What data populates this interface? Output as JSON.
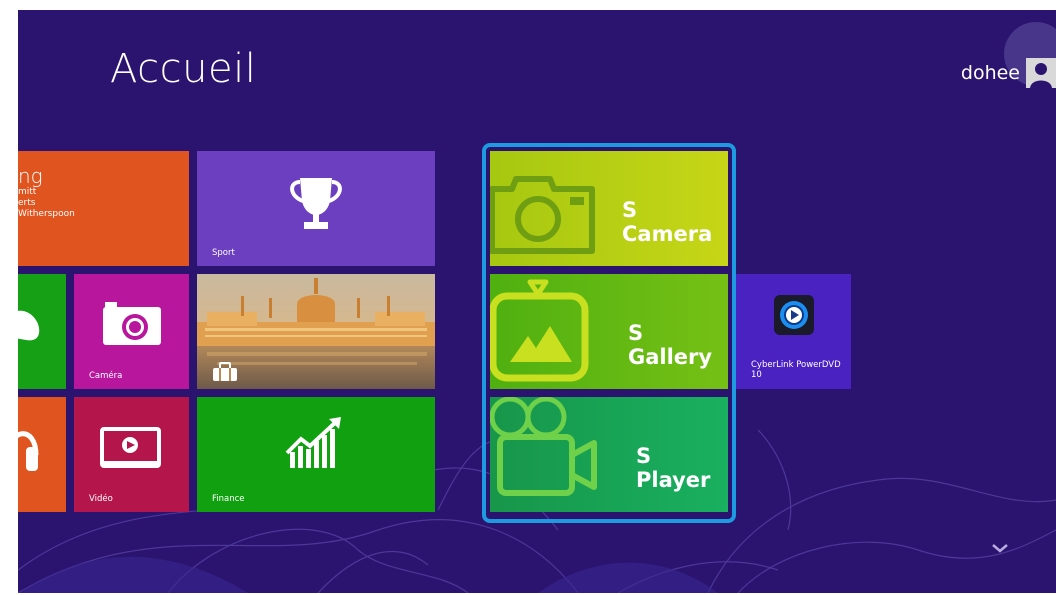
{
  "start": {
    "title": "Accueil",
    "user_name": "dohee"
  },
  "tiles": {
    "people": {
      "lines": [
        "ng",
        "mitt",
        "erts",
        "Witherspoon"
      ]
    },
    "sport": {
      "label": "Sport"
    },
    "camera": {
      "label": "Caméra"
    },
    "video": {
      "label": "Vidéo"
    },
    "finance": {
      "label": "Finance"
    },
    "s_camera": {
      "label": "S Camera"
    },
    "s_gallery": {
      "label": "S Gallery"
    },
    "s_player": {
      "label": "S Player"
    },
    "powerdvd": {
      "label": "CyberLink PowerDVD 10"
    }
  },
  "colors": {
    "background": "#2a1470",
    "people": "#e0541f",
    "sport": "#6b3fbf",
    "xbox": "#16a016",
    "camera": "#b8169c",
    "music": "#e0541f",
    "video": "#b4164c",
    "finance": "#10a010",
    "s_camera": "#b5cc10",
    "s_gallery": "#5cb910",
    "s_player": "#12a84e",
    "powerdvd": "#4a22c2",
    "group_frame": "#1e9be0"
  },
  "icons": [
    "trophy-icon",
    "camera-icon",
    "video-icon",
    "chart-icon",
    "headphones-icon",
    "game-controller-icon",
    "luggage-icon",
    "s-camera-icon",
    "s-gallery-icon",
    "s-player-icon",
    "powerdvd-icon",
    "chevron-down-icon",
    "user-avatar-icon"
  ]
}
